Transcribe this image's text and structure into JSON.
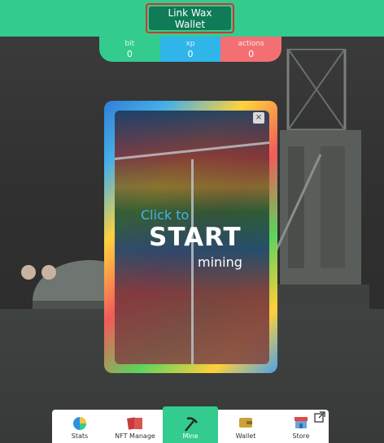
{
  "header": {
    "link_wallet_label": "Link Wax Wallet"
  },
  "stats": [
    {
      "label": "bit",
      "value": "0"
    },
    {
      "label": "xp",
      "value": "0"
    },
    {
      "label": "actions",
      "value": "0"
    }
  ],
  "mining_card": {
    "close_symbol": "×",
    "click_text": "Click to",
    "start_text": "START",
    "mining_text": "mining"
  },
  "bottom_nav": [
    {
      "label": "Stats",
      "icon": "pie-chart-icon"
    },
    {
      "label": "NFT Manage",
      "icon": "cards-icon"
    },
    {
      "label": "Mine",
      "icon": "pickaxe-icon",
      "active": true
    },
    {
      "label": "Wallet",
      "icon": "wallet-icon"
    },
    {
      "label": "Store",
      "icon": "store-icon"
    }
  ],
  "colors": {
    "brand_green": "#33cc8e",
    "button_dark_green": "#0f7b57",
    "highlight_red": "#d8322c",
    "xp_blue": "#2fb5ea",
    "actions_red": "#f36f73"
  }
}
